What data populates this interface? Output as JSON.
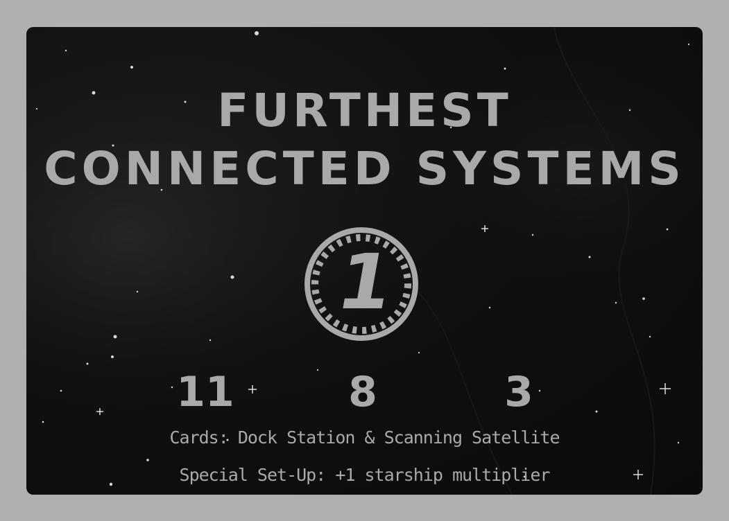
{
  "card": {
    "title_line_1": "FURTHEST",
    "title_line_2": "CONNECTED SYSTEMS",
    "badge_number": "1",
    "stats": [
      "11",
      "8",
      "3"
    ],
    "cards_text": "Cards: Dock Station & Scanning Satellite",
    "setup_text": "Special Set-Up: +1 starship multiplier"
  },
  "colors": {
    "page_background": "#b0b0b0",
    "card_background": "#0f0f0f",
    "text": "#a9a9a9"
  },
  "icons": {
    "badge": "numbered-gear-badge-icon"
  }
}
